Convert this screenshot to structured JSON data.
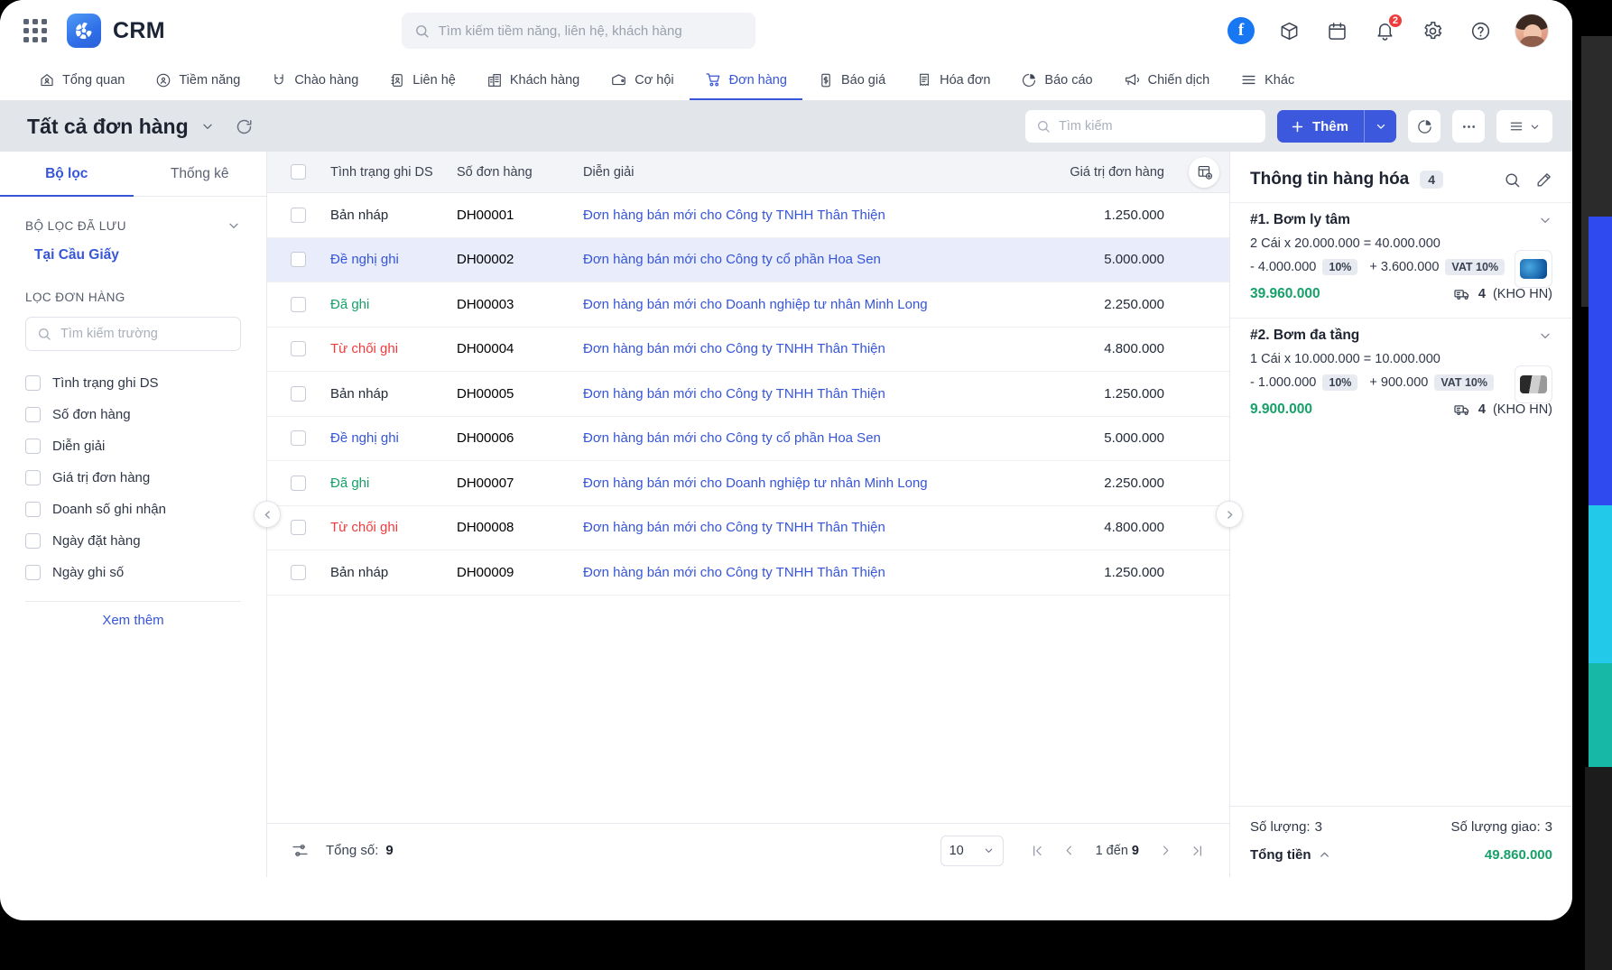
{
  "app": {
    "brand": "CRM",
    "global_search_placeholder": "Tìm kiếm tiềm năng, liên hệ, khách hàng",
    "notification_count": "2"
  },
  "nav": {
    "items": [
      {
        "label": "Tổng quan",
        "icon": "home-icon",
        "active": false
      },
      {
        "label": "Tiềm năng",
        "icon": "lead-icon",
        "active": false
      },
      {
        "label": "Chào hàng",
        "icon": "magnet-icon",
        "active": false
      },
      {
        "label": "Liên hệ",
        "icon": "contact-icon",
        "active": false
      },
      {
        "label": "Khách hàng",
        "icon": "building-icon",
        "active": false
      },
      {
        "label": "Cơ hội",
        "icon": "wallet-icon",
        "active": false
      },
      {
        "label": "Đơn hàng",
        "icon": "cart-icon",
        "active": true
      },
      {
        "label": "Báo giá",
        "icon": "quote-icon",
        "active": false
      },
      {
        "label": "Hóa đơn",
        "icon": "invoice-icon",
        "active": false
      },
      {
        "label": "Báo cáo",
        "icon": "piechart-icon",
        "active": false
      },
      {
        "label": "Chiến dịch",
        "icon": "megaphone-icon",
        "active": false
      },
      {
        "label": "Khác",
        "icon": "hamburger-icon",
        "active": false
      }
    ]
  },
  "toolbar": {
    "view_title": "Tất cả đơn hàng",
    "search_placeholder": "Tìm kiếm",
    "add_label": "Thêm"
  },
  "left_panel": {
    "tabs": [
      {
        "label": "Bộ lọc",
        "active": true
      },
      {
        "label": "Thống kê",
        "active": false
      }
    ],
    "saved_section_title": "BỘ LỌC ĐÃ LƯU",
    "saved_filters": [
      "Tại Cầu Giấy"
    ],
    "filter_section_title": "LỌC ĐƠN HÀNG",
    "field_search_placeholder": "Tìm kiếm trường",
    "fields": [
      "Tình trạng ghi DS",
      "Số đơn hàng",
      "Diễn giải",
      "Giá trị đơn hàng",
      "Doanh số ghi nhận",
      "Ngày đặt hàng",
      "Ngày ghi số"
    ],
    "more_label": "Xem thêm"
  },
  "table": {
    "columns": [
      "Tình trạng ghi DS",
      "Số đơn hàng",
      "Diễn giải",
      "Giá trị đơn hàng"
    ],
    "rows": [
      {
        "status": "Bản nháp",
        "status_kind": "draft",
        "number": "DH00001",
        "description": "Đơn hàng bán mới cho Công ty TNHH Thân Thiện",
        "value": "1.250.000",
        "selected": false
      },
      {
        "status": "Đề nghị ghi",
        "status_kind": "proposed",
        "number": "DH00002",
        "description": "Đơn hàng bán mới cho Công ty cổ phần Hoa Sen",
        "value": "5.000.000",
        "selected": true
      },
      {
        "status": "Đã ghi",
        "status_kind": "recorded",
        "number": "DH00003",
        "description": "Đơn hàng bán mới cho Doanh nghiệp tư nhân Minh Long",
        "value": "2.250.000",
        "selected": false
      },
      {
        "status": "Từ chối ghi",
        "status_kind": "rejected",
        "number": "DH00004",
        "description": "Đơn hàng bán mới cho Công ty TNHH Thân Thiện",
        "value": "4.800.000",
        "selected": false
      },
      {
        "status": "Bản nháp",
        "status_kind": "draft",
        "number": "DH00005",
        "description": "Đơn hàng bán mới cho Công ty TNHH Thân Thiện",
        "value": "1.250.000",
        "selected": false
      },
      {
        "status": "Đề nghị ghi",
        "status_kind": "proposed",
        "number": "DH00006",
        "description": "Đơn hàng bán mới cho Công ty cổ phần Hoa Sen",
        "value": "5.000.000",
        "selected": false
      },
      {
        "status": "Đã ghi",
        "status_kind": "recorded",
        "number": "DH00007",
        "description": "Đơn hàng bán mới cho Doanh nghiệp tư nhân Minh Long",
        "value": "2.250.000",
        "selected": false
      },
      {
        "status": "Từ chối ghi",
        "status_kind": "rejected",
        "number": "DH00008",
        "description": "Đơn hàng bán mới cho Công ty TNHH Thân Thiện",
        "value": "4.800.000",
        "selected": false
      },
      {
        "status": "Bản nháp",
        "status_kind": "draft",
        "number": "DH00009",
        "description": "Đơn hàng bán mới cho Công ty TNHH Thân Thiện",
        "value": "1.250.000",
        "selected": false
      }
    ],
    "footer": {
      "total_label": "Tổng số:",
      "total_value": "9",
      "page_size": "10",
      "range_prefix": "1 đến ",
      "range_total": "9"
    }
  },
  "right_panel": {
    "title": "Thông tin hàng hóa",
    "count": "4",
    "products": [
      {
        "title": "#1. Bơm ly tâm",
        "calc": "2 Cái x 20.000.000 = 40.000.000",
        "discount_amount": "- 4.000.000",
        "discount_tag": "10%",
        "vat_amount": "+ 3.600.000",
        "vat_tag": "VAT 10%",
        "total": "39.960.000",
        "delivery_qty": "4",
        "warehouse": "(KHO HN)",
        "thumb": "pump-centrifugal-thumb"
      },
      {
        "title": "#2. Bơm đa tầng",
        "calc": "1 Cái x 10.000.000 = 10.000.000",
        "discount_amount": "- 1.000.000",
        "discount_tag": "10%",
        "vat_amount": "+ 900.000",
        "vat_tag": "VAT 10%",
        "total": "9.900.000",
        "delivery_qty": "4",
        "warehouse": "(KHO HN)",
        "thumb": "pump-multistage-thumb"
      }
    ],
    "footer": {
      "qty_label": "Số lượng:",
      "qty_value": "3",
      "delivered_label": "Số lượng giao:",
      "delivered_value": "3",
      "total_label": "Tổng tiền",
      "total_value": "49.860.000"
    }
  },
  "colors": {
    "accent": "#3655d8",
    "success": "#16a06a",
    "danger": "#ef3b3b",
    "facebook": "#1877f2"
  }
}
